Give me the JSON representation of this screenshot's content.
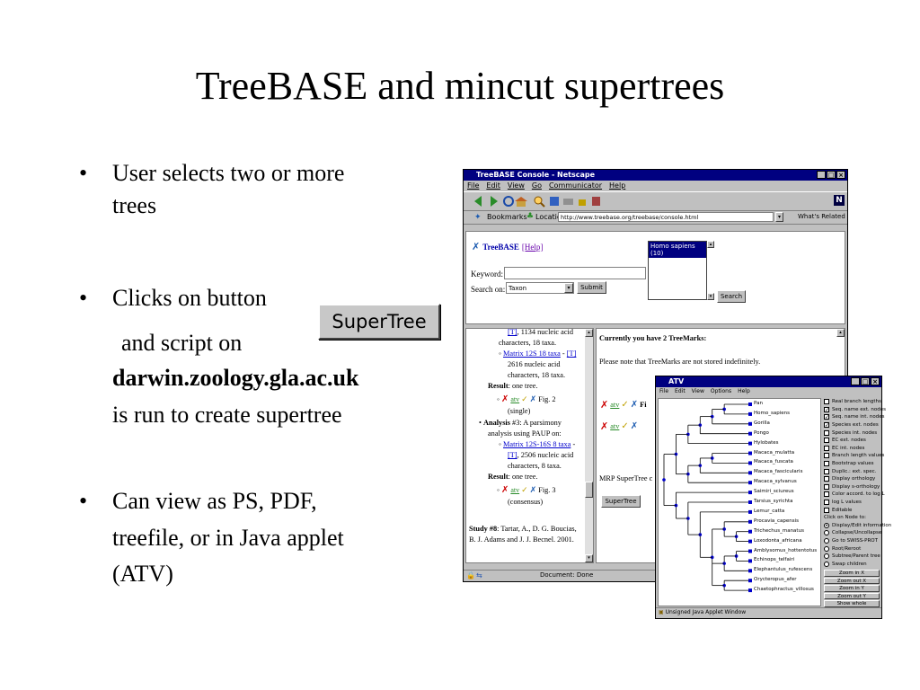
{
  "slide": {
    "title": "TreeBASE and mincut supertrees",
    "bullets": [
      {
        "lines": [
          "User selects two or more",
          "trees"
        ]
      },
      {
        "lines": [
          "Clicks on button",
          "and script on",
          "darwin.zoology.gla.ac.uk",
          "is run to create supertree"
        ]
      },
      {
        "lines": [
          "Can view as PS, PDF,",
          "treefile, or in Java applet",
          "(ATV)"
        ]
      }
    ],
    "bullet_char": "•",
    "button_label": "SuperTree"
  },
  "netscape": {
    "title": "TreeBASE Console - Netscape",
    "menu": [
      "File",
      "Edit",
      "View",
      "Go",
      "Communicator",
      "Help"
    ],
    "bookmarks": "Bookmarks",
    "location_label": "Location:",
    "url": "http://www.treebase.org/treebase/console.html",
    "whats_related": "What's Related",
    "logo": "TreeBASE",
    "help_link": "[Help]",
    "keyword_label": "Keyword:",
    "search_on_label": "Search on:",
    "search_on_value": "Taxon",
    "submit": "Submit",
    "taxon_list_item": "Homo sapiens (10)",
    "search_btn": "Search",
    "left_pane": {
      "l1": "[T], 1134 nucleic acid",
      "l2": "characters, 18 taxa.",
      "matrix1_link": "Matrix 12S 18 taxa",
      "matrix1_sep": " - ",
      "matrix1_t": "[T]",
      "l3": "2616 nucleic acid",
      "l4": "characters, 18 taxa.",
      "result1_label": "Result",
      "result1_text": ": one tree.",
      "fig2": "Fig. 2",
      "single": "(single)",
      "analysis_label": "Analysis",
      "analysis_text": " #3: A parsimony",
      "analysis_l2": "analysis using PAUP on:",
      "matrix2_link": "Matrix 12S-16S 8 taxa",
      "matrix2_t": "[T]",
      "l5": ", 2506 nucleic acid",
      "l6": "characters, 8 taxa.",
      "result2_label": "Result",
      "result2_text": ": one tree.",
      "fig3": "Fig. 3",
      "consensus": "(consensus)",
      "study_label": "Study #8",
      "study_text": ": Tartar, A., D. G. Boucias,",
      "study_l2": "B. J. Adams and J. J. Becnel. 2001."
    },
    "right_pane": {
      "treemarks": "Currently you have 2 TreeMarks:",
      "note": "Please note that TreeMarks are not stored indefinitely.",
      "mrp": "MRP SuperTree c",
      "supertree_btn": "SuperTree",
      "atv_text": "atv"
    },
    "status": "Document: Done"
  },
  "atv": {
    "title": "ATV",
    "menu": [
      "File",
      "Edit",
      "View",
      "Options",
      "Help"
    ],
    "taxa": [
      "Pan",
      "Homo_sapiens",
      "Gorilla",
      "Pongo",
      "Hylobates",
      "Macaca_mulatta",
      "Macaca_fuscata",
      "Macaca_fascicularis",
      "Macaca_sylvanus",
      "Saimiri_sciureus",
      "Tarsius_syrichta",
      "Lemur_catta",
      "Procavia_capensis",
      "Trichechus_manatus",
      "Loxodonta_africana",
      "Amblysomus_hottentotus",
      "Echinops_telfairi",
      "Elephantulus_rufescens",
      "Orycteropus_afer",
      "Chaetophractus_villosus"
    ],
    "options": [
      {
        "label": "Real branch lengths",
        "checked": false
      },
      {
        "label": "Seq. name ext. nodes",
        "checked": true
      },
      {
        "label": "Seq. name int. nodes",
        "checked": true
      },
      {
        "label": "Species ext. nodes",
        "checked": true
      },
      {
        "label": "Species int. nodes",
        "checked": false
      },
      {
        "label": "EC ext. nodes",
        "checked": false
      },
      {
        "label": "EC int. nodes",
        "checked": false
      },
      {
        "label": "Branch length values",
        "checked": false
      },
      {
        "label": "Bootstrap values",
        "checked": false
      },
      {
        "label": "Duplic.: ext. spec.",
        "checked": false
      },
      {
        "label": "Display orthology",
        "checked": false
      },
      {
        "label": "Display s-orthology",
        "checked": false
      },
      {
        "label": "Color accord. to log L",
        "checked": false
      },
      {
        "label": "log L values",
        "checked": false
      },
      {
        "label": "Editable",
        "checked": false
      }
    ],
    "click_label": "Click on Node to:",
    "radios": [
      {
        "label": "Display/Edit information",
        "selected": true
      },
      {
        "label": "Collapse/Uncollapse",
        "selected": false
      },
      {
        "label": "Go to SWISS-PROT",
        "selected": false
      },
      {
        "label": "Root/Reroot",
        "selected": false
      },
      {
        "label": "Subtree/Parent tree",
        "selected": false
      },
      {
        "label": "Swap children",
        "selected": false
      }
    ],
    "zoom_buttons": [
      "Zoom in X",
      "Zoom out X",
      "Zoom in Y",
      "Zoom out Y",
      "Show whole"
    ],
    "status": "Unsigned Java Applet Window"
  }
}
